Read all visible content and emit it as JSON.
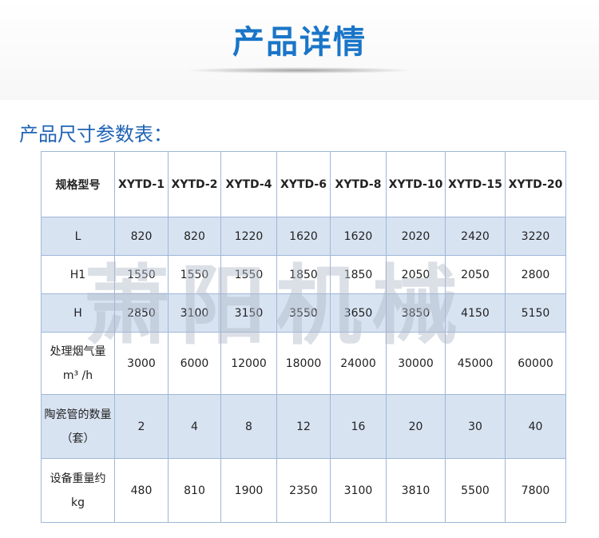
{
  "page_title": "产品详情",
  "section_title": "产品尺寸参数表：",
  "watermark": "萧阳机械",
  "table": {
    "header": [
      "规格型号",
      "XYTD-1",
      "XYTD-2",
      "XYTD-4",
      "XYTD-6",
      "XYTD-8",
      "XYTD-10",
      "XYTD-15",
      "XYTD-20"
    ],
    "rows": [
      [
        "L",
        "820",
        "820",
        "1220",
        "1620",
        "1620",
        "2020",
        "2420",
        "3220"
      ],
      [
        "H1",
        "1550",
        "1550",
        "1550",
        "1850",
        "1850",
        "2050",
        "2050",
        "2800"
      ],
      [
        "H",
        "2850",
        "3100",
        "3150",
        "3550",
        "3650",
        "3850",
        "4150",
        "5150"
      ],
      [
        "处理烟气量 m³ /h",
        "3000",
        "6000",
        "12000",
        "18000",
        "24000",
        "30000",
        "45000",
        "60000"
      ],
      [
        "陶瓷管的数量（套）",
        "2",
        "4",
        "8",
        "12",
        "16",
        "20",
        "30",
        "40"
      ],
      [
        "设备重量约 kg",
        "480",
        "810",
        "1900",
        "2350",
        "3100",
        "3810",
        "5500",
        "7800"
      ]
    ]
  }
}
